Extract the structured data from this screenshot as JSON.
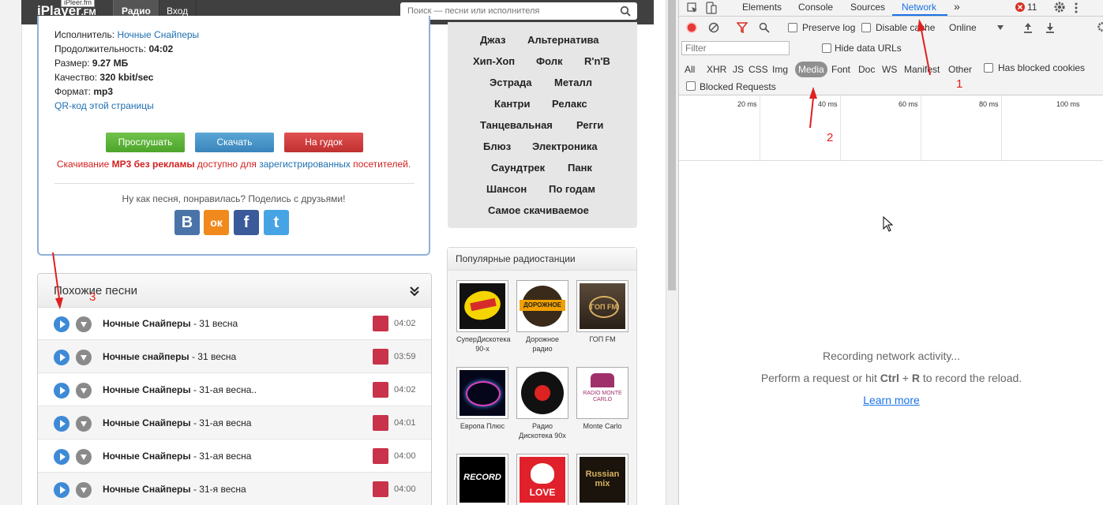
{
  "site": {
    "logo": "iPlayer",
    "logo_suffix": ".FM",
    "logo_tooltip": "iPleer.fm",
    "nav": {
      "radio": "Радио",
      "login": "Вход"
    },
    "search_placeholder": "Поиск — песни или исполнителя",
    "info": {
      "artist_label": "Исполнитель:",
      "artist_value": "Ночные Снайперы",
      "duration_label": "Продолжительность:",
      "duration_value": "04:02",
      "size_label": "Размер:",
      "size_value": "9.27 МБ",
      "quality_label": "Качество:",
      "quality_value": "320 kbit/sec",
      "format_label": "Формат:",
      "format_value": "mp3",
      "qr_link": "QR-код этой страницы"
    },
    "buttons": {
      "listen": "Прослушать",
      "download": "Скачать",
      "ringtone": "На гудок"
    },
    "ad": {
      "p1": "Скачивание ",
      "p2": "MP3 без рекламы",
      "p3": " доступно для ",
      "p4": "зарегистрированных",
      "p5": " посетителей."
    },
    "share_text": "Ну как песня, понравилась? Поделись с друзьями!",
    "social": {
      "vk": "В",
      "ok": "ок",
      "fb": "f",
      "tw": "t"
    },
    "similar": {
      "title": "Похожие песни",
      "songs": [
        {
          "artist": "Ночные Снайперы",
          "title": " - 31 весна",
          "duration": "04:02"
        },
        {
          "artist": "Ночные снайперы",
          "title": " - 31 весна",
          "duration": "03:59"
        },
        {
          "artist": "Ночные Снайперы",
          "title": " - 31-ая весна..",
          "duration": "04:02"
        },
        {
          "artist": "Ночные Снайперы",
          "title": " - 31-ая весна",
          "duration": "04:01"
        },
        {
          "artist": "Ночные Снайперы",
          "title": " - 31-ая весна",
          "duration": "04:00"
        },
        {
          "artist": "Ночные Снайперы",
          "title": " - 31-я весна",
          "duration": "04:00"
        }
      ]
    },
    "genres": [
      "Джаз",
      "Альтернатива",
      "Хип-Хоп",
      "Фолк",
      "R'n'B",
      "Эстрада",
      "Металл",
      "Кантри",
      "Релакс",
      "Танцевальная",
      "Регги",
      "Блюз",
      "Электроника",
      "Саундтрек",
      "Панк",
      "Шансон",
      "По годам",
      "Самое скачиваемое"
    ],
    "radio": {
      "title": "Популярные радиостанции",
      "stations": [
        {
          "name": "СуперДискотека 90-х"
        },
        {
          "name": "Дорожное радио",
          "logo_text": "ДОРОЖНОЕ"
        },
        {
          "name": "ГОП FM",
          "logo_text": "ГОП FM"
        },
        {
          "name": "Европа Плюс"
        },
        {
          "name": "Радио Дискотека 90х"
        },
        {
          "name": "Monte Carlo",
          "logo_text": "RADIO MONTE CARLO"
        },
        {
          "name": "",
          "logo_text": "RECORD"
        },
        {
          "name": "",
          "logo_text": "LOVE"
        },
        {
          "name": "",
          "logo_text": "Russian mix"
        }
      ]
    }
  },
  "annotations": {
    "n1": "1",
    "n2": "2",
    "n3": "3"
  },
  "devtools": {
    "tabs": {
      "elements": "Elements",
      "console": "Console",
      "sources": "Sources",
      "network": "Network",
      "more": "»"
    },
    "error_count": "11",
    "toolbar": {
      "preserve_log": "Preserve log",
      "disable_cache": "Disable cache",
      "throttle": "Online"
    },
    "filter_placeholder": "Filter",
    "hide_data_urls": "Hide data URLs",
    "types": {
      "all": "All",
      "xhr": "XHR",
      "js": "JS",
      "css": "CSS",
      "img": "Img",
      "media": "Media",
      "font": "Font",
      "doc": "Doc",
      "ws": "WS",
      "manifest": "Manifest",
      "other": "Other"
    },
    "has_blocked_cookies": "Has blocked cookies",
    "blocked_requests": "Blocked Requests",
    "ticks": [
      "20 ms",
      "40 ms",
      "60 ms",
      "80 ms",
      "100 ms"
    ],
    "empty": {
      "line1": "Recording network activity...",
      "pre": "Perform a request or hit ",
      "ctrl": "Ctrl",
      "plus": " + ",
      "r": "R",
      "post": " to record the reload.",
      "learn_more": "Learn more"
    },
    "colors": {
      "accent": "#1a73e8",
      "record": "#e53935"
    }
  }
}
